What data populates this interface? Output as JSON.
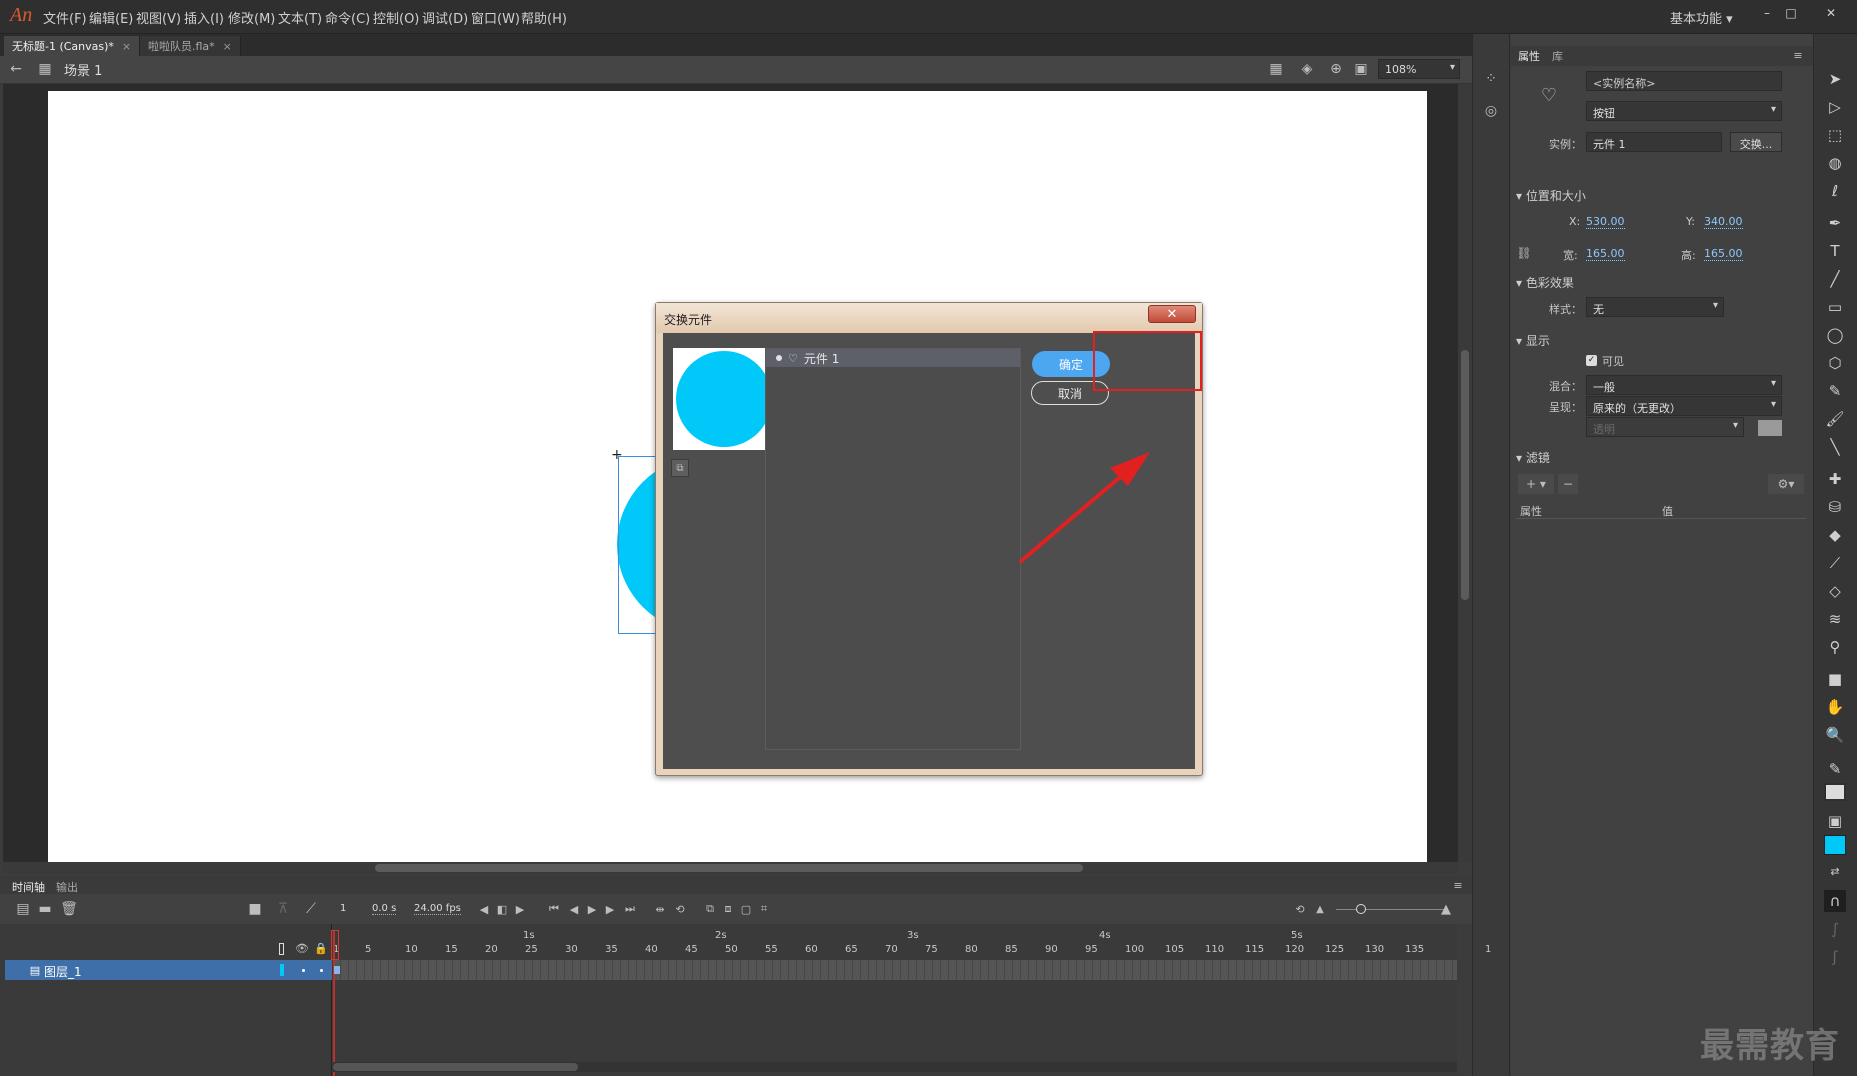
{
  "app": {
    "logo": "An"
  },
  "menu": [
    "文件(F)",
    "编辑(E)",
    "视图(V)",
    "插入(I)",
    "修改(M)",
    "文本(T)",
    "命令(C)",
    "控制(O)",
    "调试(D)",
    "窗口(W)",
    "帮助(H)"
  ],
  "workspace": {
    "label": "基本功能"
  },
  "window_controls": {
    "minimize": "–",
    "maximize": "□",
    "close": "✕"
  },
  "doc_tabs": [
    {
      "label": "无标题-1 (Canvas)*",
      "close": "×"
    },
    {
      "label": "啦啦队员.fla*",
      "close": "×"
    }
  ],
  "scene": {
    "label": "场景 1",
    "zoom": "108%"
  },
  "dialog": {
    "title": "交换元件",
    "close": "✕",
    "symbol_item": "元件 1",
    "ok": "确定",
    "cancel": "取消"
  },
  "properties": {
    "tab_props": "属性",
    "tab_library": "库",
    "instance_name_placeholder": "<实例名称>",
    "type": "按钮",
    "instance_label": "实例：",
    "instance_value": "元件 1",
    "swap_button": "交换...",
    "section_position": "位置和大小",
    "x_label": "X:",
    "x_value": "530.00",
    "y_label": "Y:",
    "y_value": "340.00",
    "w_label": "宽:",
    "w_value": "165.00",
    "h_label": "高:",
    "h_value": "165.00",
    "section_color": "色彩效果",
    "style_label": "样式：",
    "style_value": "无",
    "section_display": "显示",
    "visible_label": "可见",
    "blend_label": "混合：",
    "blend_value": "一般",
    "render_label": "呈现：",
    "render_value": "原来的（无更改）",
    "transparent": "透明",
    "section_filters": "滤镜",
    "col_property": "属性",
    "col_value": "值"
  },
  "timeline": {
    "tab_timeline": "时间轴",
    "tab_output": "输出",
    "frame": "1",
    "time": "0.0 s",
    "fps": "24.00 fps",
    "layer_name": "图层_1",
    "seconds": [
      "1s",
      "2s",
      "3s",
      "4s",
      "5s"
    ],
    "ticks": [
      "1",
      "5",
      "10",
      "15",
      "20",
      "25",
      "30",
      "35",
      "40",
      "45",
      "50",
      "55",
      "60",
      "65",
      "70",
      "75",
      "80",
      "85",
      "90",
      "95",
      "100",
      "105",
      "110",
      "115",
      "120",
      "125",
      "130",
      "135",
      "1"
    ]
  },
  "watermark": "最需教育",
  "colors": {
    "accent_blue": "#4da6f0",
    "shape_fill": "#00c8f8",
    "highlight_red": "#e32020"
  }
}
